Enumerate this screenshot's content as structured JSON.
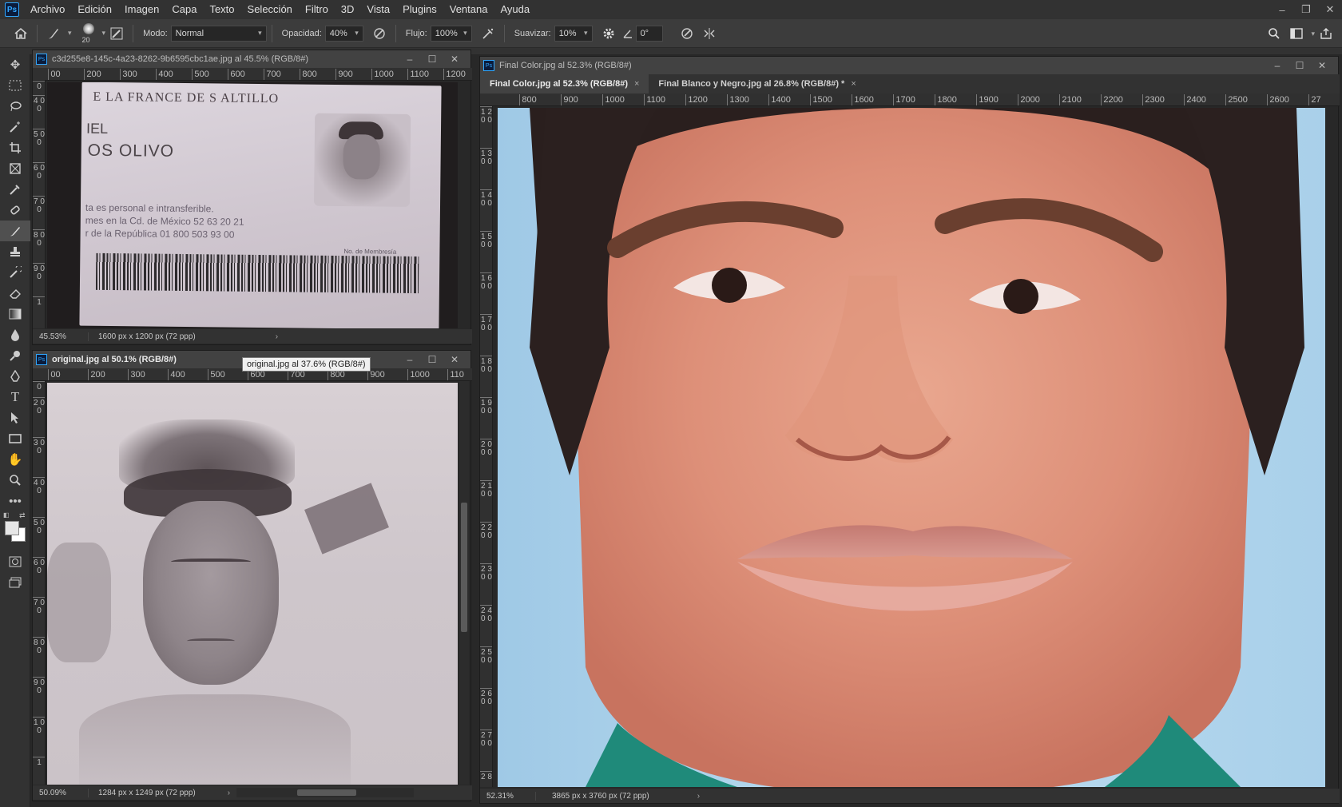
{
  "menu": {
    "logo": "Ps",
    "items": [
      "Archivo",
      "Edición",
      "Imagen",
      "Capa",
      "Texto",
      "Selección",
      "Filtro",
      "3D",
      "Vista",
      "Plugins",
      "Ventana",
      "Ayuda"
    ]
  },
  "window_controls": {
    "minimize": "–",
    "restore": "❐",
    "close": "✕"
  },
  "options": {
    "home_icon": "home-icon",
    "brush_icon": "brush-icon",
    "brush_size": "20",
    "mode_label": "Modo:",
    "mode_value": "Normal",
    "opacity_label": "Opacidad:",
    "opacity_value": "40%",
    "flow_label": "Flujo:",
    "flow_value": "100%",
    "smoothing_label": "Suavizar:",
    "smoothing_value": "10%",
    "angle_value": "0°"
  },
  "tools": [
    "move-icon",
    "marquee-icon",
    "lasso-icon",
    "magic-wand-icon",
    "crop-icon",
    "frame-icon",
    "eyedropper-icon",
    "healing-brush-icon",
    "brush-icon",
    "clone-stamp-icon",
    "history-brush-icon",
    "eraser-icon",
    "gradient-icon",
    "blur-icon",
    "dodge-icon",
    "pen-icon",
    "type-icon",
    "path-selection-icon",
    "rectangle-icon",
    "hand-icon",
    "zoom-icon",
    "more-icon"
  ],
  "colors": {
    "foreground": "#e6e6e6",
    "background": "#ffffff",
    "accent": "#31a8ff"
  },
  "doc1": {
    "title": "c3d255e8-145c-4a23-8262-9b6595cbc1ae.jpg al 45.5% (RGB/8#)",
    "ruler_h": [
      "00",
      "200",
      "300",
      "400",
      "500",
      "600",
      "700",
      "800",
      "900",
      "1000",
      "1100",
      "1200"
    ],
    "ruler_v": [
      "0",
      "4 0 0",
      "5 0 0",
      "6 0 0",
      "7 0 0",
      "8 0 0",
      "9 0 0",
      "1"
    ],
    "card_line1": "E LA FRANCE DE S ALTILLO",
    "card_line2": "IEL",
    "card_line3": "OS OLIVO",
    "card_line4": "ta es personal e intransferible.",
    "card_line5": "mes en la Cd. de México 52 63 20 21",
    "card_line6": "r de la República 01 800 503 93 00",
    "card_line7": "No. de Membresía",
    "zoom": "45.53%",
    "dims": "1600 px x 1200 px (72 ppp)"
  },
  "doc2": {
    "title": "original.jpg al 50.1% (RGB/8#)",
    "ruler_h": [
      "00",
      "200",
      "300",
      "400",
      "500",
      "600",
      "700",
      "800",
      "900",
      "1000",
      "110"
    ],
    "ruler_v": [
      "0",
      "2 0 0",
      "3 0 0",
      "4 0 0",
      "5 0 0",
      "6 0 0",
      "7 0 0",
      "8 0 0",
      "9 0 0",
      "1 0 0",
      "1"
    ],
    "tooltip": "original.jpg al 37.6% (RGB/8#)",
    "zoom": "50.09%",
    "dims": "1284 px x 1249 px (72 ppp)"
  },
  "doc3": {
    "title": "Final Color.jpg al 52.3% (RGB/8#)",
    "tabs": [
      {
        "label": "Final Color.jpg al 52.3% (RGB/8#)",
        "close": "×"
      },
      {
        "label": "Final Blanco y Negro.jpg al 26.8% (RGB/8#) *",
        "close": "×"
      }
    ],
    "ruler_h": [
      "800",
      "900",
      "1000",
      "1100",
      "1200",
      "1300",
      "1400",
      "1500",
      "1600",
      "1700",
      "1800",
      "1900",
      "2000",
      "2100",
      "2200",
      "2300",
      "2400",
      "2500",
      "2600",
      "27"
    ],
    "ruler_v": [
      "1 2 0 0",
      "1 3 0 0",
      "1 4 0 0",
      "1 5 0 0",
      "1 6 0 0",
      "1 7 0 0",
      "1 8 0 0",
      "1 9 0 0",
      "2 0 0 0",
      "2 1 0 0",
      "2 2 0 0",
      "2 3 0 0",
      "2 4 0 0",
      "2 5 0 0",
      "2 6 0 0",
      "2 7 0 0",
      "2 8"
    ],
    "zoom": "52.31%",
    "dims": "3865 px x 3760 px (72 ppp)"
  }
}
